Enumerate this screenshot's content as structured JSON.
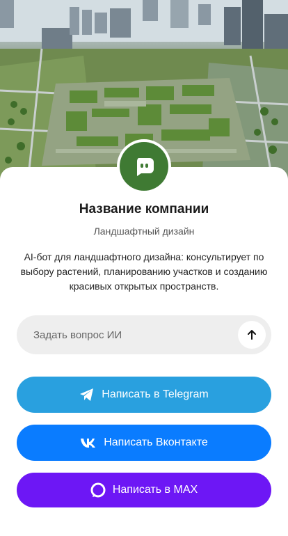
{
  "company": {
    "name": "Название компании",
    "subtitle": "Ландшафтный дизайн",
    "description": "AI-бот для ландшафтного дизайна: консультирует по выбору растений, планированию участков и созданию красивых открытых пространств."
  },
  "ask": {
    "placeholder": "Задать вопрос ИИ",
    "send_icon": "arrow-up-icon"
  },
  "buttons": {
    "telegram": {
      "label": "Написать в Telegram",
      "icon": "telegram-icon",
      "color": "#29a0df"
    },
    "vk": {
      "label": "Написать Вконтакте",
      "icon": "vk-icon",
      "color": "#0a7cff"
    },
    "max": {
      "label": "Написать в MAX",
      "icon": "max-icon",
      "color": "#6d17f5"
    }
  },
  "avatar": {
    "icon": "chat-bot-icon",
    "color": "#3f7a33"
  }
}
